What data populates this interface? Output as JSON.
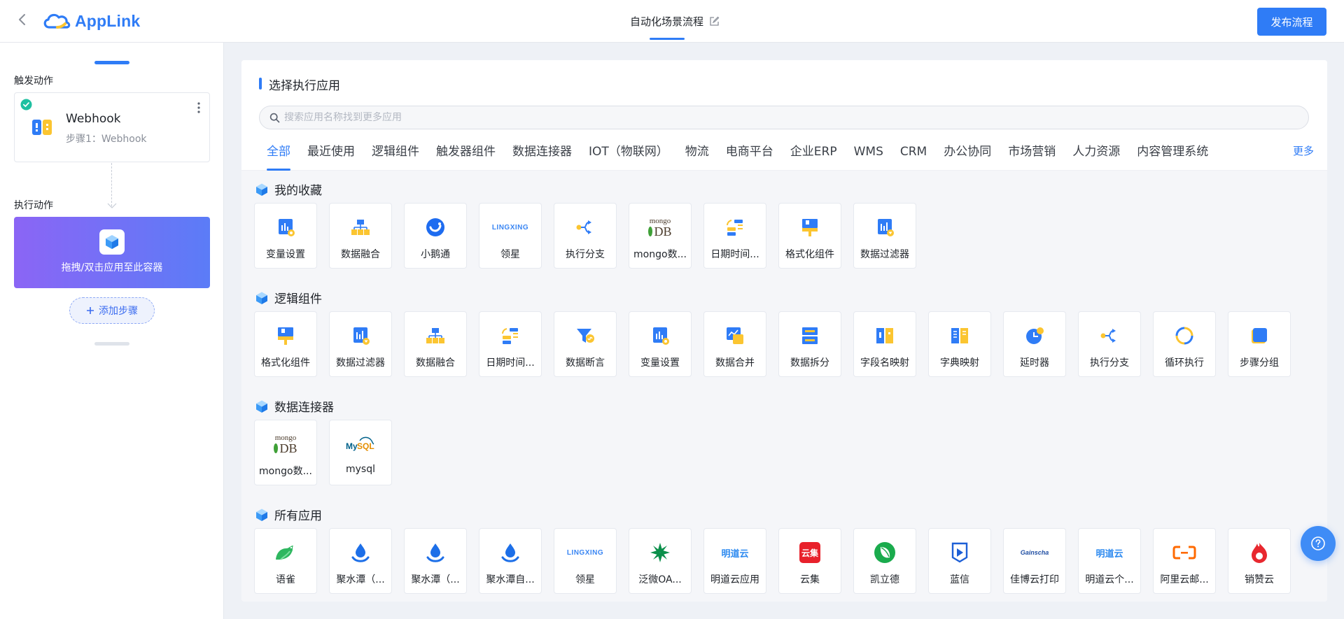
{
  "header": {
    "app_name": "AppLink",
    "flow_title": "自动化场景流程",
    "publish_label": "发布流程"
  },
  "left": {
    "trigger_label": "触发动作",
    "trigger_card": {
      "title": "Webhook",
      "subtitle": "步骤1：Webhook"
    },
    "exec_label": "执行动作",
    "exec_card_text": "拖拽/双击应用至此容器",
    "add_step_label": "添加步骤"
  },
  "main": {
    "title": "选择执行应用",
    "search_placeholder": "搜索应用名称找到更多应用",
    "tabs": [
      "全部",
      "最近使用",
      "逻辑组件",
      "触发器组件",
      "数据连接器",
      "IOT（物联网）",
      "物流",
      "电商平台",
      "企业ERP",
      "WMS",
      "CRM",
      "办公协同",
      "市场营销",
      "人力资源",
      "内容管理系统"
    ],
    "active_tab": "全部",
    "more_label": "更多"
  },
  "groups": {
    "favorites": {
      "title": "我的收藏",
      "items": [
        {
          "label": "变量设置",
          "icon": "variable-icon"
        },
        {
          "label": "数据融合",
          "icon": "merge-icon"
        },
        {
          "label": "小鹅通",
          "icon": "xiaoetong-icon"
        },
        {
          "label": "领星",
          "icon": "lingxing-logo",
          "logo_text": "LINGXING"
        },
        {
          "label": "执行分支",
          "icon": "branch-icon"
        },
        {
          "label": "mongo数...",
          "icon": "mongodb-logo",
          "logo_text": "mongo",
          "logo_text2": "DB"
        },
        {
          "label": "日期时间...",
          "icon": "datetime-icon"
        },
        {
          "label": "格式化组件",
          "icon": "formatter-icon"
        },
        {
          "label": "数据过滤器",
          "icon": "filter-icon"
        }
      ]
    },
    "logic": {
      "title": "逻辑组件",
      "items": [
        {
          "label": "格式化组件",
          "icon": "formatter-icon"
        },
        {
          "label": "数据过滤器",
          "icon": "filter-icon"
        },
        {
          "label": "数据融合",
          "icon": "merge-icon"
        },
        {
          "label": "日期时间...",
          "icon": "datetime-icon"
        },
        {
          "label": "数据断言",
          "icon": "assert-icon"
        },
        {
          "label": "变量设置",
          "icon": "variable-icon"
        },
        {
          "label": "数据合并",
          "icon": "combine-icon"
        },
        {
          "label": "数据拆分",
          "icon": "split-icon"
        },
        {
          "label": "字段名映射",
          "icon": "field-map-icon"
        },
        {
          "label": "字典映射",
          "icon": "dict-map-icon"
        },
        {
          "label": "延时器",
          "icon": "delay-icon"
        },
        {
          "label": "执行分支",
          "icon": "branch-icon"
        },
        {
          "label": "循环执行",
          "icon": "loop-icon"
        },
        {
          "label": "步骤分组",
          "icon": "group-icon"
        }
      ]
    },
    "connectors": {
      "title": "数据连接器",
      "items": [
        {
          "label": "mongo数...",
          "icon": "mongodb-logo",
          "logo_text": "mongo",
          "logo_text2": "DB"
        },
        {
          "label": "mysql",
          "icon": "mysql-logo",
          "logo_text": "MySQL"
        }
      ]
    },
    "all_apps": {
      "title": "所有应用",
      "items": [
        {
          "label": "语雀",
          "icon": "yuque-logo"
        },
        {
          "label": "聚水潭（...",
          "icon": "jushuitan-logo"
        },
        {
          "label": "聚水潭（...",
          "icon": "jushuitan-logo"
        },
        {
          "label": "聚水潭自...",
          "icon": "jushuitan-logo"
        },
        {
          "label": "领星",
          "icon": "lingxing-logo",
          "logo_text": "LINGXING"
        },
        {
          "label": "泛微OA...",
          "icon": "weaver-logo"
        },
        {
          "label": "明道云应用",
          "icon": "mingdao-logo",
          "logo_text": "明道云"
        },
        {
          "label": "云集",
          "icon": "yunji-logo",
          "logo_text": "云集"
        },
        {
          "label": "凯立德",
          "icon": "kailide-logo"
        },
        {
          "label": "蓝信",
          "icon": "lanxin-logo"
        },
        {
          "label": "佳博云打印",
          "icon": "gainscha-logo",
          "logo_text": "Gainscha"
        },
        {
          "label": "明道云个...",
          "icon": "mingdao-logo",
          "logo_text": "明道云"
        },
        {
          "label": "阿里云邮...",
          "icon": "aliyun-logo"
        },
        {
          "label": "销赞云",
          "icon": "xiaozan-logo"
        }
      ]
    }
  },
  "colors": {
    "primary": "#2f7cf6",
    "logic_yellow": "#fbc531",
    "logic_blue": "#2f7cf6",
    "exec_gradient_start": "#8b65f5",
    "exec_gradient_end": "#5b7cf7"
  }
}
